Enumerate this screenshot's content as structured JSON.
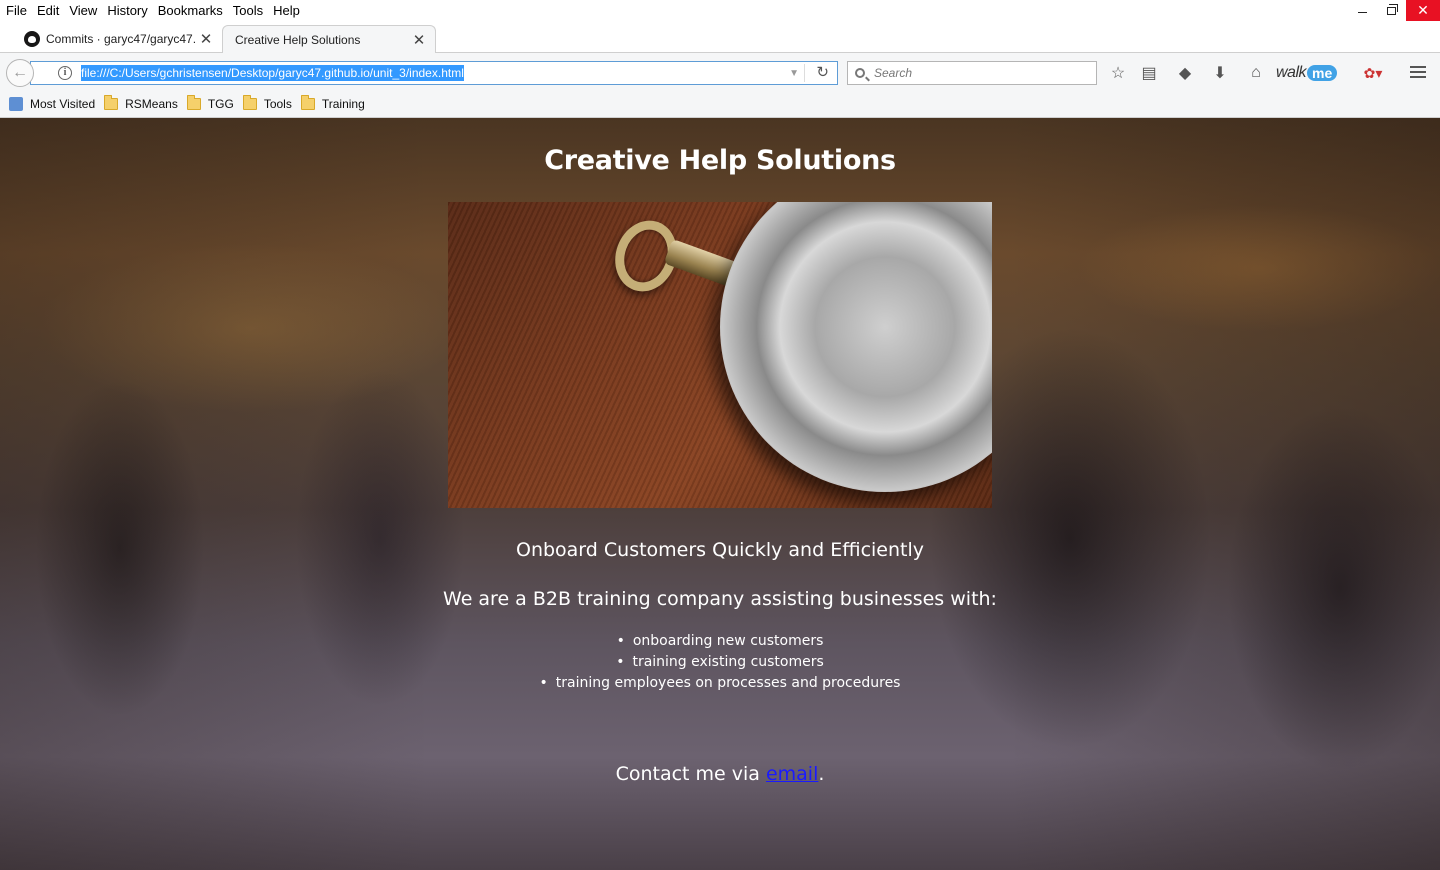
{
  "menubar": {
    "items": [
      "File",
      "Edit",
      "View",
      "History",
      "Bookmarks",
      "Tools",
      "Help"
    ]
  },
  "window_controls": {
    "minimize": "minimize-icon",
    "restore": "restore-icon",
    "close": "close-icon"
  },
  "tabs": [
    {
      "title": "Commits · garyc47/garyc47.",
      "icon": "github-icon",
      "active": false
    },
    {
      "title": "Creative Help Solutions",
      "active": true
    }
  ],
  "navbar": {
    "url": "file:///C:/Users/gchristensen/Desktop/garyc47.github.io/unit_3/index.html",
    "search_placeholder": "Search",
    "walkme_text": "walk",
    "walkme_badge": "me"
  },
  "bookmarks": [
    {
      "label": "Most Visited",
      "icon": "most-visited-icon"
    },
    {
      "label": "RSMeans",
      "icon": "folder-icon"
    },
    {
      "label": "TGG",
      "icon": "folder-icon"
    },
    {
      "label": "Tools",
      "icon": "folder-icon"
    },
    {
      "label": "Training",
      "icon": "folder-icon"
    }
  ],
  "page": {
    "title": "Creative Help Solutions",
    "subtitle": "Onboard Customers Quickly and Efficiently",
    "intro": "We are a B2B training company assisting businesses with:",
    "services": [
      "onboarding new customers",
      "training existing customers",
      "training employees on processes and procedures"
    ],
    "contact_prefix": "Contact me via ",
    "contact_link": "email",
    "contact_suffix": "."
  },
  "colors": {
    "selection": "#3399ff",
    "link": "#1a1aff",
    "close_button": "#e81123",
    "walkme_accent": "#41a2e6"
  }
}
